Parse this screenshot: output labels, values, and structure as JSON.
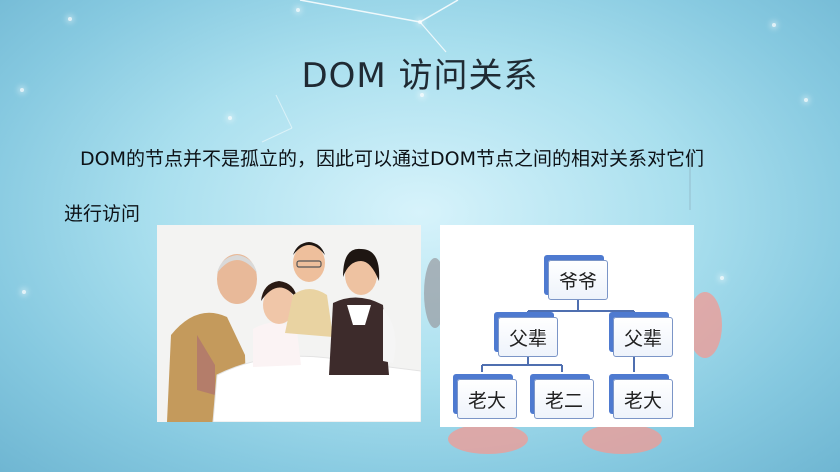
{
  "slide": {
    "title": "DOM 访问关系",
    "paragraph_line1": "DOM的节点并不是孤立的，因此可以通过DOM节点之间的相对关系对它们",
    "paragraph_line2": "进行访问"
  },
  "tree": {
    "root": "爷爷",
    "parent_left": "父辈",
    "parent_right": "父辈",
    "child_1": "老大",
    "child_2": "老二",
    "child_3": "老大"
  },
  "colors": {
    "node_shadow": "#4e7ad0",
    "connector": "#4f6fb0",
    "background_center": "#d7f3fb"
  }
}
